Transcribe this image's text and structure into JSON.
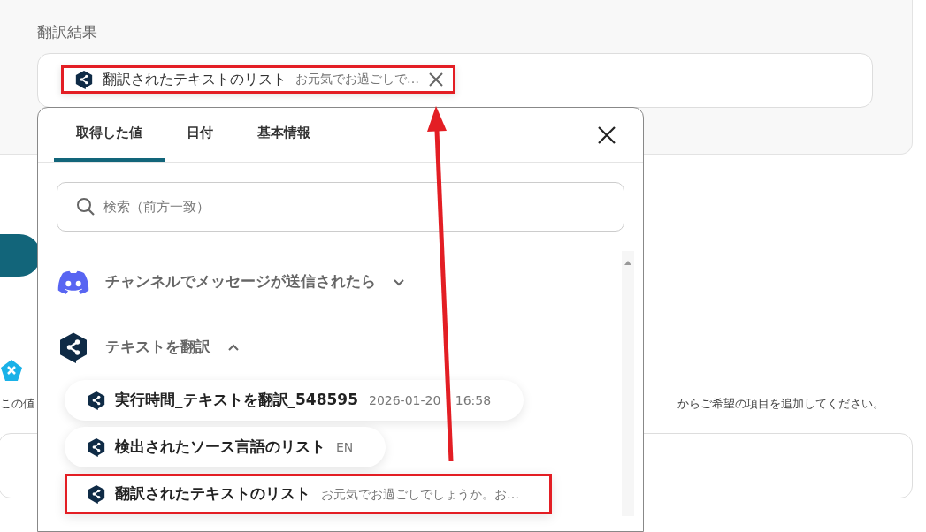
{
  "result_field": {
    "label": "翻訳結果",
    "chip": {
      "kind": "deepl",
      "title": "翻訳されたテキストのリスト",
      "value": "お元気でお過ごしで…",
      "highlighted": true
    }
  },
  "background": {
    "note_left": "この値",
    "note_right": "からご希望の項目を追加してください。"
  },
  "picker": {
    "tabs": [
      {
        "label": "取得した値",
        "selected": true
      },
      {
        "label": "日付",
        "selected": false
      },
      {
        "label": "基本情報",
        "selected": false
      }
    ],
    "search": {
      "placeholder": "検索（前方一致）"
    },
    "groups": [
      {
        "kind": "discord",
        "title": "チャンネルでメッセージが送信されたら",
        "expanded": false
      },
      {
        "kind": "deepl",
        "title": "テキストを翻訳",
        "expanded": true,
        "items": [
          {
            "title": "実行時間_テキストを翻訳_548595",
            "value": "2026-01-20 16:58",
            "highlighted": false
          },
          {
            "title": "検出されたソース言語のリスト",
            "value": "EN",
            "highlighted": false
          },
          {
            "title": "翻訳されたテキストのリスト",
            "value": "お元気でお過ごしでしょうか。お…",
            "highlighted": true
          }
        ]
      }
    ]
  }
}
